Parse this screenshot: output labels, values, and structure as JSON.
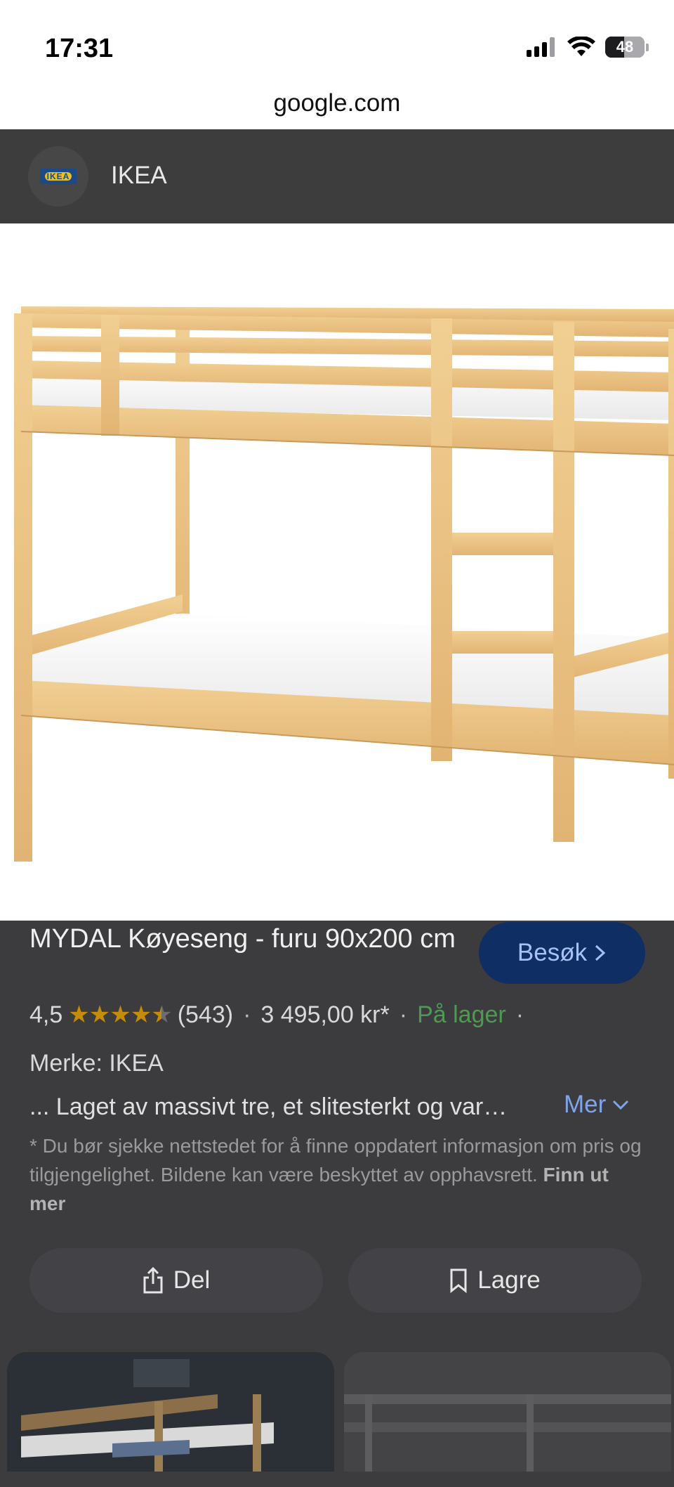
{
  "status_bar": {
    "time": "17:31",
    "battery": "48"
  },
  "browser": {
    "url": "google.com"
  },
  "site": {
    "name": "IKEA",
    "logo_text": "IKEA"
  },
  "product": {
    "title": "MYDAL Køyeseng - furu 90x200 cm",
    "visit_label": "Besøk",
    "rating": "4,5",
    "rating_value": 4.5,
    "reviews": "(543)",
    "price": "3 495,00 kr*",
    "availability": "På lager",
    "brand": "Merke: IKEA",
    "description": "... Laget av massivt tre, et slitesterkt og var…",
    "more_label": "Mer",
    "disclaimer": "* Du bør sjekke nettstedet for å finne oppdatert informasjon om pris og tilgjengelighet. Bildene kan være beskyttet av opphavsrett.",
    "learn_more": "Finn ut mer"
  },
  "actions": {
    "share_label": "Del",
    "save_label": "Lagre"
  },
  "colors": {
    "accent_link": "#7fa4e8",
    "in_stock": "#4e9a52",
    "visit_bg": "#0f2e63",
    "star": "#c58b0b"
  },
  "icons": [
    "signal-icon",
    "wifi-icon",
    "battery-icon",
    "ikea-logo",
    "chevron-right-icon",
    "chevron-down-icon",
    "share-icon",
    "bookmark-icon"
  ]
}
